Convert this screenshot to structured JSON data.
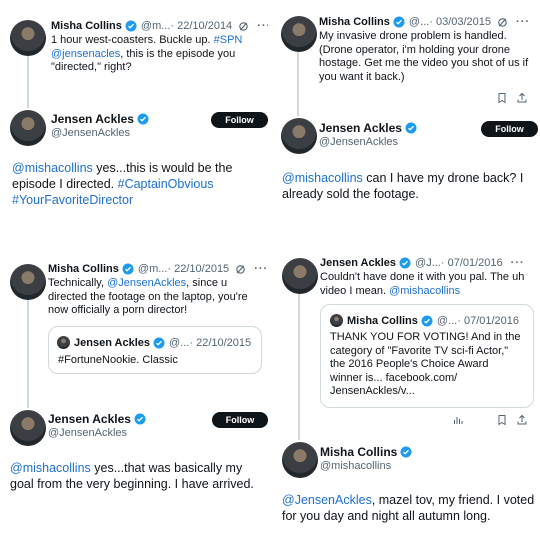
{
  "panel_tl": {
    "tweet": {
      "name": "Misha Collins",
      "handle_time": "@m...",
      "date": "· 22/10/2014",
      "text_pre": "1 hour west-coasters. Buckle up. ",
      "hashtag": "#SPN",
      "mention": "@jensenacles",
      "text_post": ", this is the episode you",
      "text_line3": "\"directed,\" right?"
    },
    "reply": {
      "name": "Jensen Ackles",
      "handle": "@JensenAckles",
      "follow_label": "Follow",
      "mention": "@mishacollins",
      "text1": " yes...this is would be the",
      "text2": "episode I directed. ",
      "tag1": "#CaptainObvious",
      "tag2": "#YourFavoriteDirector"
    }
  },
  "panel_tr": {
    "tweet": {
      "name": "Misha Collins",
      "handle_time": "@...",
      "date": "· 03/03/2015",
      "line1": "My invasive drone problem is handled.",
      "line2": "(Drone operator, i'm holding your drone",
      "line3": "hostage. Get me the video you shot of us if",
      "line4": "you want it back.)"
    },
    "reply": {
      "name": "Jensen Ackles",
      "handle": "@JensenAckles",
      "follow_label": "Follow",
      "mention": "@mishacollins",
      "text1": " can I have my drone back?  I",
      "text2": "already sold the footage."
    }
  },
  "panel_bl": {
    "tweet": {
      "name": "Misha Collins",
      "handle_time": "@m...",
      "date": "· 22/10/2015",
      "line1": "Technically, ",
      "mention": "@JensenAckles",
      "line1b": ", since u",
      "line2": "directed the footage on the laptop, you're",
      "line3": "now officially a porn director!"
    },
    "quote": {
      "name": "Jensen Ackles",
      "handle_time": "@...",
      "date": "· 22/10/2015",
      "text": "#FortuneNookie.  Classic"
    },
    "reply": {
      "name": "Jensen Ackles",
      "handle": "@JensenAckles",
      "follow_label": "Follow",
      "mention": "@mishacollins",
      "text1": " yes...that was basically my",
      "text2": "goal from the very beginning.  I have arrived."
    }
  },
  "panel_br": {
    "tweet": {
      "name": "Jensen Ackles",
      "handle_time": "@J...",
      "date": "· 07/01/2016",
      "line1": "Couldn't have done it with you pal.  The uh",
      "line2": "video I mean.  ",
      "mention": "@mishacollins"
    },
    "quote": {
      "name": "Misha Collins",
      "handle_time": "@...",
      "date": "· 07/01/2016",
      "line1": "THANK YOU FOR VOTING! And in the",
      "line2": "category of \"Favorite TV sci-fi Actor,\"",
      "line3": "the 2016 People's Choice Award",
      "line4": "winner is... facebook.com/",
      "line5": "JensenAckles/v..."
    },
    "reply": {
      "name": "Misha Collins",
      "handle": "@mishacollins",
      "mention": "@JensenAckles",
      "text1": ", mazel tov, my friend. I voted",
      "text2": "for you day and night all autumn long."
    }
  },
  "colors": {
    "link": "#1d6fd1",
    "verified": "#1d9bf0",
    "button": "#0f1419",
    "muted": "#536471"
  },
  "icons": [
    "verified-badge-icon",
    "grok-icon",
    "more-icon",
    "bookmark-icon",
    "share-icon",
    "analytics-icon"
  ]
}
